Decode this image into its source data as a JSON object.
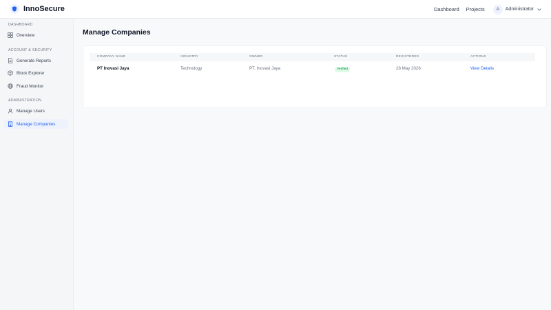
{
  "app": {
    "name": "InnoSecure"
  },
  "topnav": {
    "links": [
      "Dashboard",
      "Projects"
    ],
    "user": {
      "initial": "A",
      "name": "Administrator"
    }
  },
  "sidebar": {
    "sections": [
      {
        "title": "DASHBOARD",
        "items": [
          {
            "label": "Overview",
            "icon": "grid-icon"
          }
        ]
      },
      {
        "title": "ACCOUNT & SECURITY",
        "items": [
          {
            "label": "Generate Reports",
            "icon": "file-icon"
          },
          {
            "label": "Block Explorer",
            "icon": "cube-icon"
          },
          {
            "label": "Fraud Monitor",
            "icon": "globe-icon"
          }
        ]
      },
      {
        "title": "ADMINISTRATION",
        "items": [
          {
            "label": "Manage Users",
            "icon": "user-icon"
          },
          {
            "label": "Manage Companies",
            "icon": "building-icon",
            "active": true
          }
        ]
      }
    ]
  },
  "page": {
    "title": "Manage Companies"
  },
  "table": {
    "columns": [
      "COMPANY NAME",
      "INDUSTRY",
      "OWNER",
      "STATUS",
      "REGISTERED",
      "ACTIONS"
    ],
    "rows": [
      {
        "company": "PT Inovasi Jaya",
        "industry": "Technology",
        "owner": "PT. Inovasi Jaya",
        "status": "Verified",
        "registered": "28 May 2026",
        "action": "View Details"
      }
    ]
  },
  "colors": {
    "accent": "#2563eb",
    "status_verified_bg": "#dcfce7",
    "status_verified_text": "#15803d"
  }
}
